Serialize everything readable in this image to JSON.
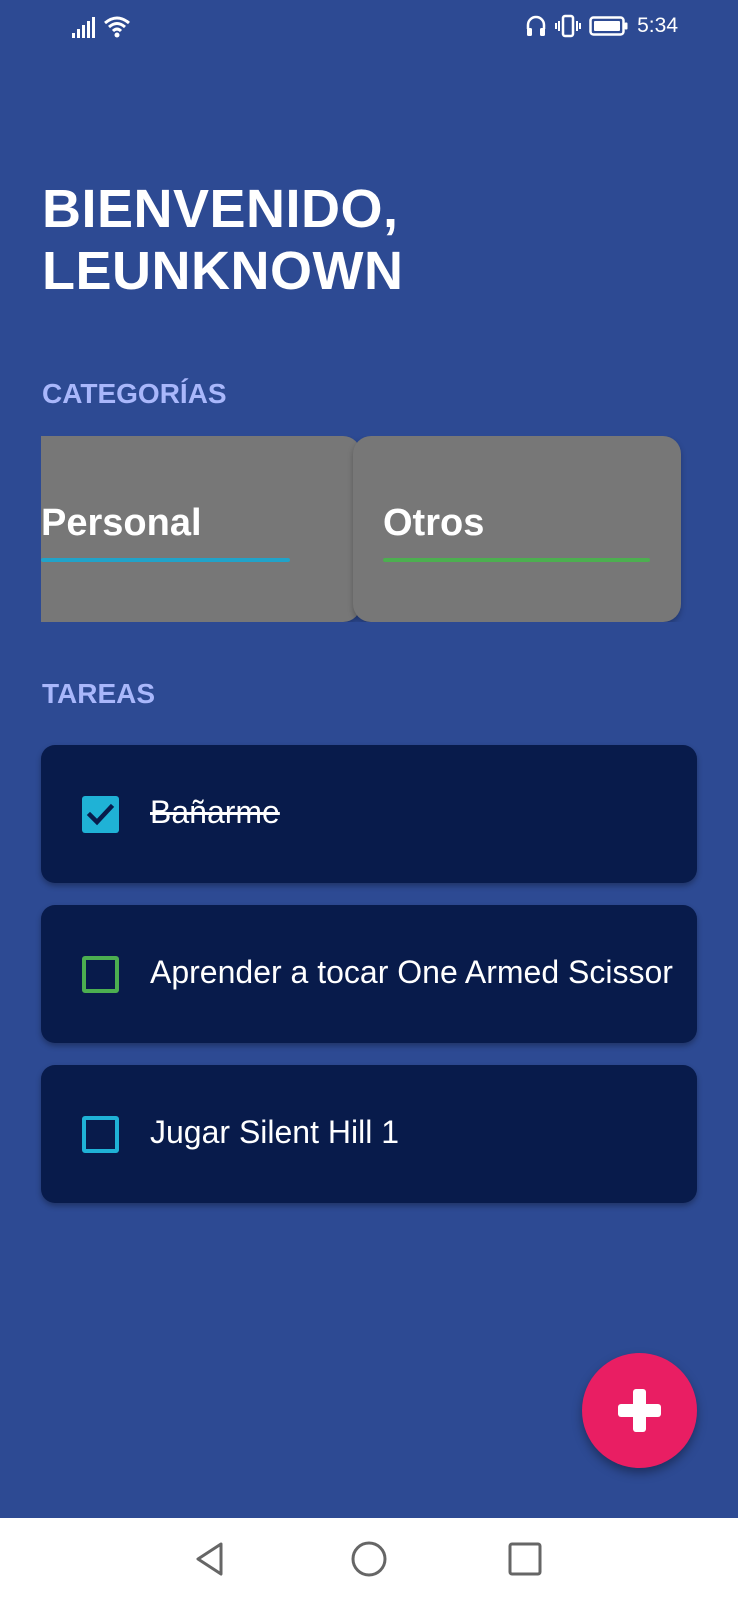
{
  "status_bar": {
    "time": "5:34",
    "icons": [
      "signal-icon",
      "wifi-icon",
      "headphones-icon",
      "vibrate-icon",
      "battery-icon"
    ]
  },
  "header": {
    "greeting_line1": "BIENVENIDO,",
    "greeting_line2": "LEUNKNOWN"
  },
  "categories": {
    "label": "CATEGORÍAS",
    "items": [
      {
        "title": "Personal",
        "accent": "#20a3c9"
      },
      {
        "title": "Otros",
        "accent": "#4caf50"
      }
    ]
  },
  "tasks": {
    "label": "TAREAS",
    "items": [
      {
        "text": "Bañarme",
        "checked": true,
        "color": "#1fb2d6"
      },
      {
        "text": "Aprender a tocar One Armed Scissor",
        "checked": false,
        "color": "#4caf50"
      },
      {
        "text": "Jugar Silent Hill 1",
        "checked": false,
        "color": "#1fb2d6"
      }
    ]
  },
  "fab": {
    "icon": "plus-icon"
  },
  "nav_bar": {
    "icons": [
      "back-icon",
      "home-icon",
      "recents-icon"
    ]
  },
  "colors": {
    "background": "#2d4a93",
    "section_label": "#a9b7fb",
    "card": "#777777",
    "task_bg": "#081b4b",
    "fab": "#e91e63"
  }
}
